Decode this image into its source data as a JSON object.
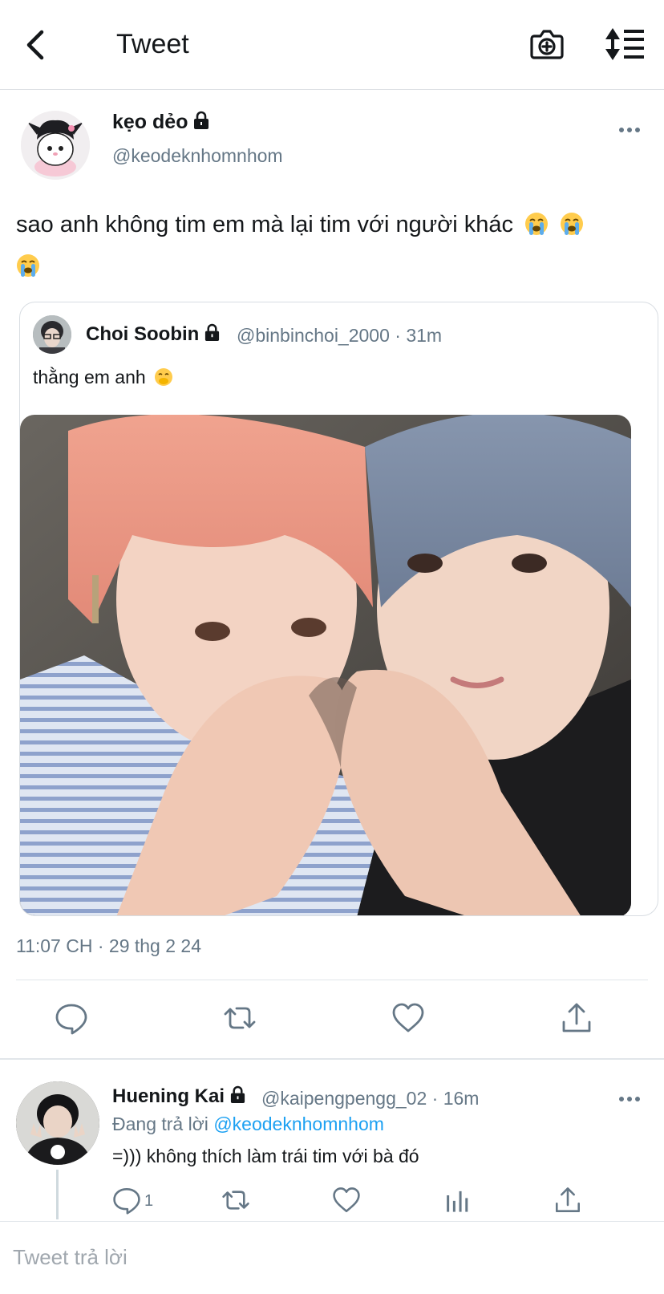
{
  "header": {
    "title": "Tweet",
    "back_icon": "chevron-left-icon",
    "camera_icon": "camera-plus-icon",
    "sort_icon": "sort-timeline-icon"
  },
  "tweet": {
    "author_name": "kẹo dẻo",
    "handle": "@keodeknhomnhom",
    "text": "sao anh không tim em mà lại tim với người khác",
    "emojis": [
      "loudly-crying-face",
      "loudly-crying-face",
      "loudly-crying-face"
    ],
    "timestamp": "11:07 CH · 29 thg 2 24",
    "actions": [
      "reply-icon",
      "retweet-icon",
      "like-icon",
      "share-icon"
    ]
  },
  "quote": {
    "author_name": "Choi Soobin",
    "handle": "@binbinchoi_2000",
    "separator": "·",
    "time": "31m",
    "text": "thằng em anh",
    "emoji": "face-with-hand-over-mouth"
  },
  "reply": {
    "author_name": "Huening Kai",
    "handle": "@kaipengpengg_02",
    "separator": "·",
    "time": "16m",
    "replying_prefix": "Đang trả lời",
    "replying_to": "@keodeknhomnhom",
    "text": "=))) không thích làm trái tim với bà đó",
    "reply_count": "1",
    "actions": [
      "reply-icon",
      "retweet-icon",
      "like-icon",
      "analytics-icon",
      "share-icon"
    ]
  },
  "reply_bar": {
    "placeholder": "Tweet trả lời"
  },
  "colors": {
    "link": "#1da1f2",
    "secondary_text": "#657786",
    "primary_text": "#14171a",
    "divider": "#e1e6ea"
  }
}
